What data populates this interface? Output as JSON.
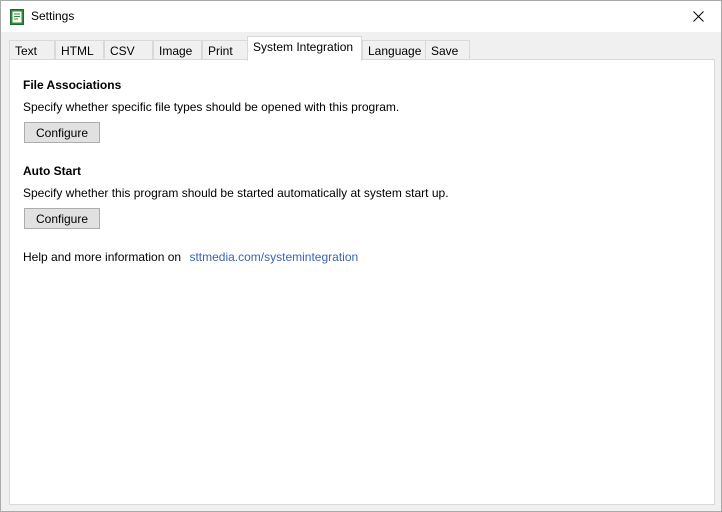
{
  "window": {
    "title": "Settings",
    "icon": "notepad-green-icon",
    "close_symbol": "close-icon"
  },
  "tabs": [
    {
      "label": "Text",
      "active": false
    },
    {
      "label": "HTML",
      "active": false
    },
    {
      "label": "CSV",
      "active": false
    },
    {
      "label": "Image",
      "active": false
    },
    {
      "label": "Print",
      "active": false
    },
    {
      "label": "System Integration",
      "active": true
    },
    {
      "label": "Language",
      "active": false
    },
    {
      "label": "Save",
      "active": false
    }
  ],
  "file_associations": {
    "title": "File Associations",
    "description": "Specify whether specific file types should be opened with this program.",
    "button_label": "Configure"
  },
  "auto_start": {
    "title": "Auto Start",
    "description": "Specify whether this program should be started automatically at system start up.",
    "button_label": "Configure"
  },
  "help": {
    "text": "Help and more information on",
    "link": "sttmedia.com/systemintegration"
  },
  "colors": {
    "link": "#3b63b5",
    "icon_green": "#2e8b3a"
  }
}
